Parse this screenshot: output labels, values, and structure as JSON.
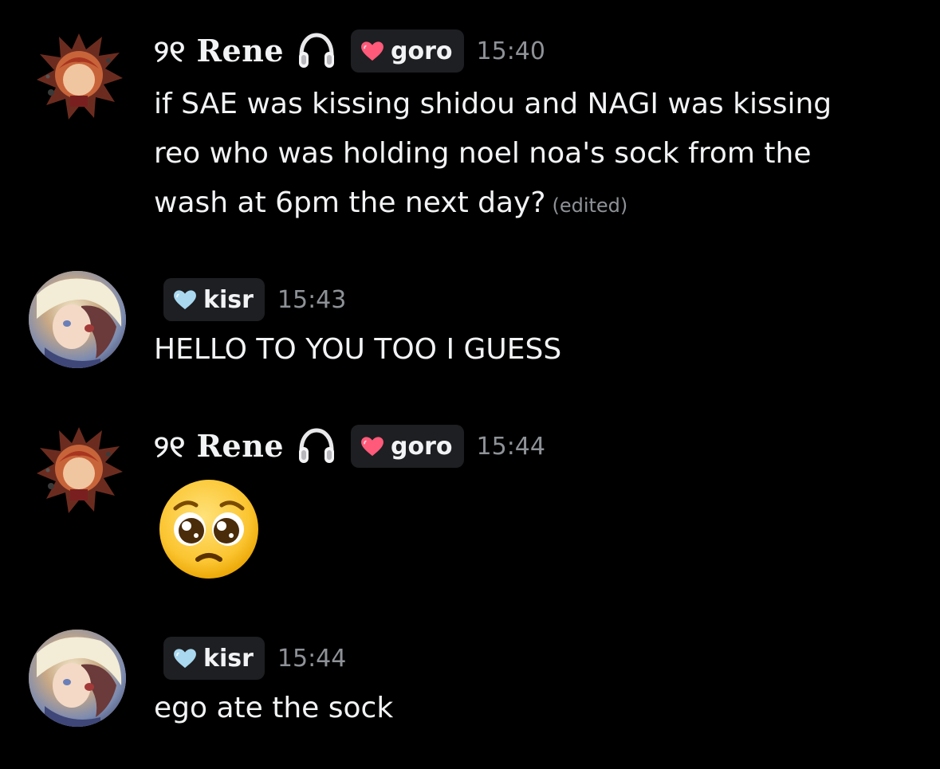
{
  "messages": [
    {
      "author": "୨୧ Rene",
      "author_badge_icon": "headphones-icon",
      "tag": {
        "label": "goro",
        "icon": "pink-heart-icon",
        "color": "#ff5a7a"
      },
      "timestamp": "15:40",
      "lines": [
        "if SAE was kissing shidou and NAGI was kissing",
        "reo who was holding noel noa's sock from the",
        "wash at 6pm the next day?"
      ],
      "edited_label": "(edited)"
    },
    {
      "author": "",
      "tag": {
        "label": "kisr",
        "icon": "light-blue-heart-icon",
        "color": "#a9d8ef"
      },
      "timestamp": "15:43",
      "text": "HELLO TO YOU TOO I GUESS"
    },
    {
      "author": "୨୧ Rene",
      "author_badge_icon": "headphones-icon",
      "tag": {
        "label": "goro",
        "icon": "pink-heart-icon",
        "color": "#ff5a7a"
      },
      "timestamp": "15:44",
      "emoji": "pleading-face-emoji"
    },
    {
      "author": "",
      "tag": {
        "label": "kisr",
        "icon": "light-blue-heart-icon",
        "color": "#a9d8ef"
      },
      "timestamp": "15:44",
      "text": "ego ate the sock"
    }
  ],
  "colors": {
    "background": "#000000",
    "text": "#f2f3f5",
    "muted": "#8e9297",
    "tag_bg": "#1e1f22"
  }
}
